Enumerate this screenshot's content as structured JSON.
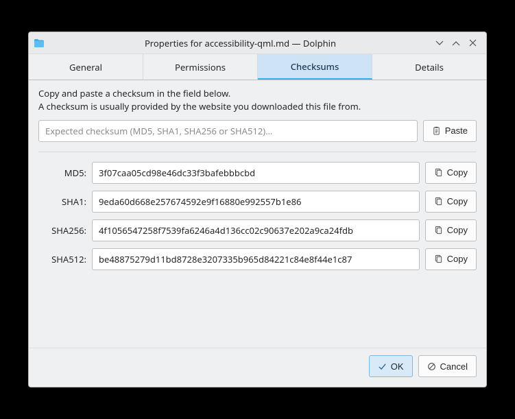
{
  "window": {
    "title": "Properties for accessibility-qml.md — Dolphin"
  },
  "tabs": {
    "general": "General",
    "permissions": "Permissions",
    "checksums": "Checksums",
    "details": "Details"
  },
  "desc": {
    "line1": "Copy and paste a checksum in the field below.",
    "line2": "A checksum is usually provided by the website you downloaded this file from."
  },
  "expected": {
    "placeholder": "Expected checksum (MD5, SHA1, SHA256 or SHA512)…",
    "paste": "Paste"
  },
  "rows": {
    "md5": {
      "label": "MD5:",
      "value": "3f07caa05cd98e46dc33f3bafebbbcbd"
    },
    "sha1": {
      "label": "SHA1:",
      "value": "9eda60d668e257674592e9f16880e992557b1e86"
    },
    "sha256": {
      "label": "SHA256:",
      "value": "4f1056547258f7539fa6246a4d136cc02c90637e202a9ca24fdb"
    },
    "sha512": {
      "label": "SHA512:",
      "value": "be48875279d11bd8728e3207335b965d84221c84e8f44e1c87"
    }
  },
  "copy": "Copy",
  "footer": {
    "ok": "OK",
    "cancel": "Cancel"
  }
}
